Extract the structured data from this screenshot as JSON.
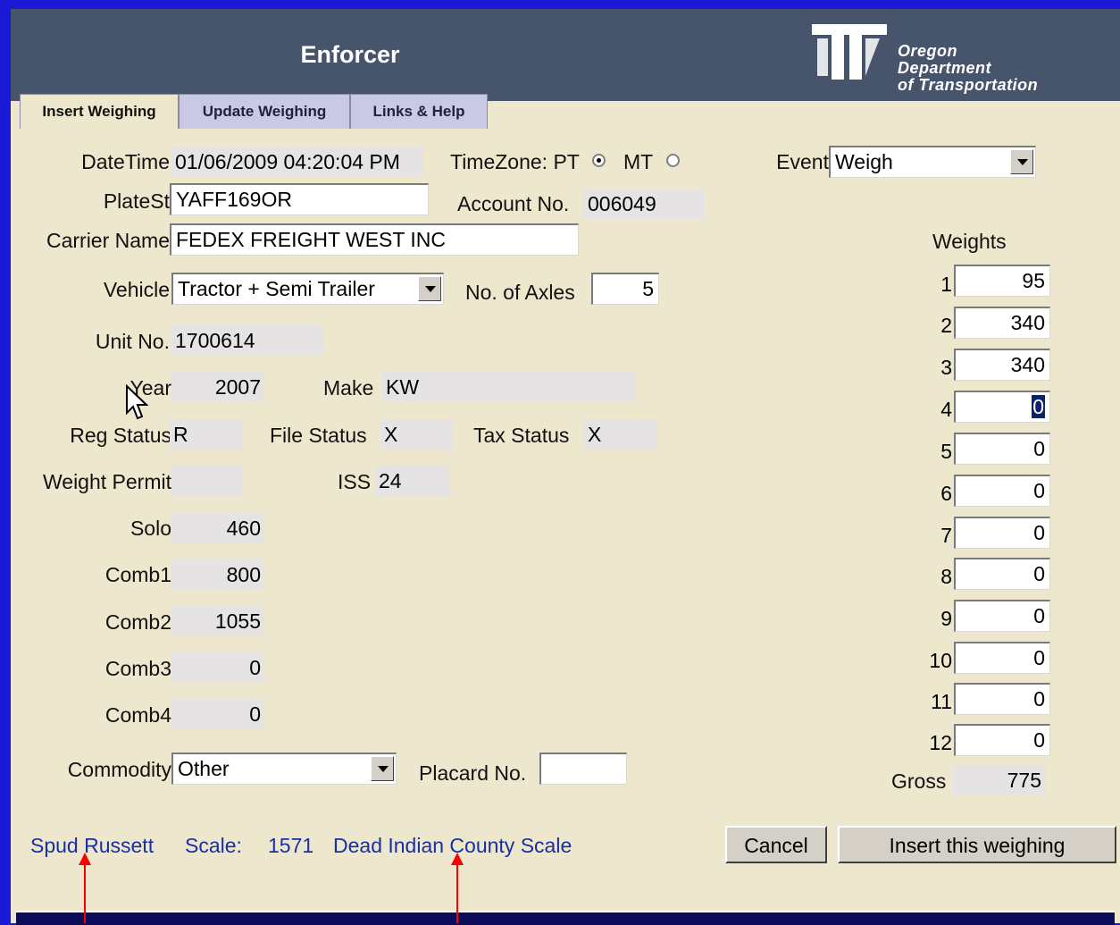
{
  "header": {
    "app_title": "Enforcer",
    "logo_line1": "Oregon",
    "logo_line2": "Department",
    "logo_line3": "of Transportation"
  },
  "tabs": [
    {
      "label": "Insert Weighing",
      "active": true
    },
    {
      "label": "Update Weighing",
      "active": false
    },
    {
      "label": "Links & Help",
      "active": false
    }
  ],
  "form": {
    "datetime_label": "DateTime",
    "datetime_value": "01/06/2009 04:20:04 PM",
    "timezone_label": "TimeZone: PT",
    "timezone_mt_label": "MT",
    "timezone_selected": "PT",
    "event_label": "Event",
    "event_value": "Weigh",
    "platest_label": "PlateSt",
    "platest_value": "YAFF169OR",
    "account_label": "Account No.",
    "account_value": "006049",
    "carrier_label": "Carrier Name",
    "carrier_value": "FEDEX FREIGHT WEST INC",
    "vehicle_label": "Vehicle",
    "vehicle_value": "Tractor + Semi Trailer",
    "axles_label": "No. of Axles",
    "axles_value": "5",
    "unit_label": "Unit No.",
    "unit_value": "1700614",
    "year_label": "Year",
    "year_value": "2007",
    "make_label": "Make",
    "make_value": "KW",
    "reg_status_label": "Reg Status",
    "reg_status_value": "R",
    "file_status_label": "File Status",
    "file_status_value": "X",
    "tax_status_label": "Tax Status",
    "tax_status_value": "X",
    "weight_permit_label": "Weight Permit",
    "weight_permit_value": "",
    "iss_label": "ISS",
    "iss_value": "24",
    "solo_label": "Solo",
    "solo_value": "460",
    "comb1_label": "Comb1",
    "comb1_value": "800",
    "comb2_label": "Comb2",
    "comb2_value": "1055",
    "comb3_label": "Comb3",
    "comb3_value": "0",
    "comb4_label": "Comb4",
    "comb4_value": "0",
    "commodity_label": "Commodity",
    "commodity_value": "Other",
    "placard_label": "Placard No.",
    "placard_value": ""
  },
  "weights": {
    "title": "Weights",
    "rows": [
      {
        "n": "1",
        "v": "95"
      },
      {
        "n": "2",
        "v": "340"
      },
      {
        "n": "3",
        "v": "340"
      },
      {
        "n": "4",
        "v": "0"
      },
      {
        "n": "5",
        "v": "0"
      },
      {
        "n": "6",
        "v": "0"
      },
      {
        "n": "7",
        "v": "0"
      },
      {
        "n": "8",
        "v": "0"
      },
      {
        "n": "9",
        "v": "0"
      },
      {
        "n": "10",
        "v": "0"
      },
      {
        "n": "11",
        "v": "0"
      },
      {
        "n": "12",
        "v": "0"
      }
    ],
    "gross_label": "Gross",
    "gross_value": "775"
  },
  "footer": {
    "officer": "Spud Russett",
    "scale_label": "Scale:",
    "scale_number": "1571",
    "scale_name": "Dead Indian County Scale",
    "cancel_label": "Cancel",
    "insert_label": "Insert this weighing"
  },
  "colors": {
    "background": "#1a1ad6",
    "header": "#46546c",
    "panel": "#ede7cd",
    "link": "#1a2fa0",
    "marker": "#ff0000"
  }
}
